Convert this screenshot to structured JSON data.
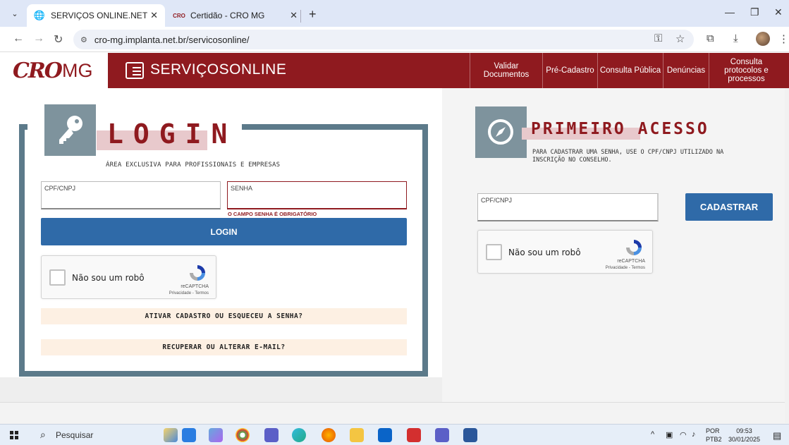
{
  "browser": {
    "tabs": [
      {
        "title": "SERVIÇOS ONLINE.NET",
        "active": true
      },
      {
        "title": "Certidão - CRO MG",
        "active": false
      }
    ],
    "url": "cro-mg.implanta.net.br/servicosonline/"
  },
  "header": {
    "logo_cro": "CRO",
    "logo_mg": "MG",
    "service_title": "SERVIÇOSONLINE",
    "nav": [
      "Validar Documentos",
      "Pré-Cadastro",
      "Consulta Pública",
      "Denúncias",
      "Consulta protocolos e processos"
    ]
  },
  "login": {
    "title": "LOGIN",
    "subtitle": "ÁREA EXCLUSIVA PARA PROFISSIONAIS E EMPRESAS",
    "cpf_label": "CPF/CNPJ",
    "cpf_value": "",
    "senha_label": "SENHA",
    "senha_value": "",
    "senha_error": "O CAMPO SENHA É OBRIGATÓRIO",
    "button": "LOGIN",
    "link_activate": "ATIVAR CADASTRO OU ESQUECEU A SENHA?",
    "link_email": "RECUPERAR OU ALTERAR E-MAIL?"
  },
  "captcha": {
    "label": "Não sou um robô",
    "brand": "reCAPTCHA",
    "terms": "Privacidade - Termos"
  },
  "primeiro_acesso": {
    "title": "PRIMEIRO ACESSO",
    "subtitle": "PARA CADASTRAR UMA SENHA, USE O CPF/CNPJ UTILIZADO NA INSCRIÇÃO NO CONSELHO.",
    "cpf_label": "CPF/CNPJ",
    "cpf_value": "",
    "button": "CADASTRAR"
  },
  "taskbar": {
    "search": "Pesquisar",
    "lang": "POR",
    "lang2": "PTB2",
    "time": "09:53",
    "date": "30/01/2025"
  },
  "colors": {
    "brand_red": "#8f1a1f",
    "button_blue": "#2f6aa8",
    "slate": "#5c7a8a"
  }
}
